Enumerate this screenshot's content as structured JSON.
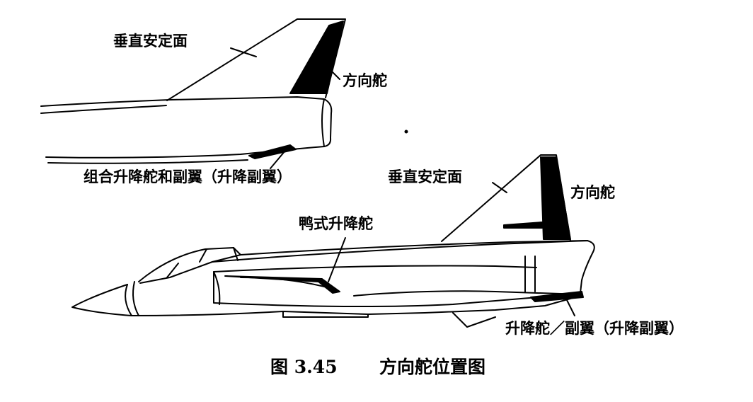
{
  "diagram": {
    "top_aircraft": {
      "fin_label": "垂直安定面",
      "rudder_label": "方向舵",
      "elevon_label": "组合升降舵和副翼（升降副翼）"
    },
    "bottom_aircraft": {
      "fin_label": "垂直安定面",
      "rudder_label": "方向舵",
      "canard_label": "鸭式升降舵",
      "elevon_label": "升降舵／副翼（升降副翼）"
    }
  },
  "caption": {
    "number": "图 3.45",
    "title": "方向舵位置图"
  },
  "colors": {
    "ink": "#000000",
    "paper": "#ffffff"
  }
}
